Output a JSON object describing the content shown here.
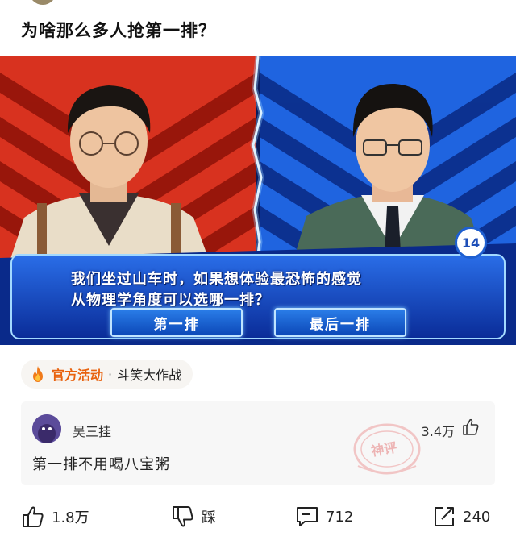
{
  "post": {
    "title": "为啥那么多人抢第一排？"
  },
  "quiz": {
    "question_line1": "我们坐过山车时，如果想体验最恐怖的感觉",
    "question_line2": "从物理学角度可以选哪一排？",
    "option1": "第一排",
    "option2": "最后一排",
    "question_number": "14"
  },
  "activity": {
    "icon": "fire-icon",
    "label": "官方活动",
    "separator": "·",
    "name": "斗笑大作战"
  },
  "comment": {
    "username": "吴三挂",
    "likes": "3.4万",
    "text": "第一排不用喝八宝粥",
    "stamp_text": "神评"
  },
  "actions": {
    "like_count": "1.8万",
    "dislike_label": "踩",
    "comment_count": "712",
    "share_count": "240"
  },
  "colors": {
    "activity_accent": "#e8620e",
    "left_panel": "#d8321f",
    "right_panel": "#1f64e0",
    "quiz_banner": "#1240b8"
  }
}
